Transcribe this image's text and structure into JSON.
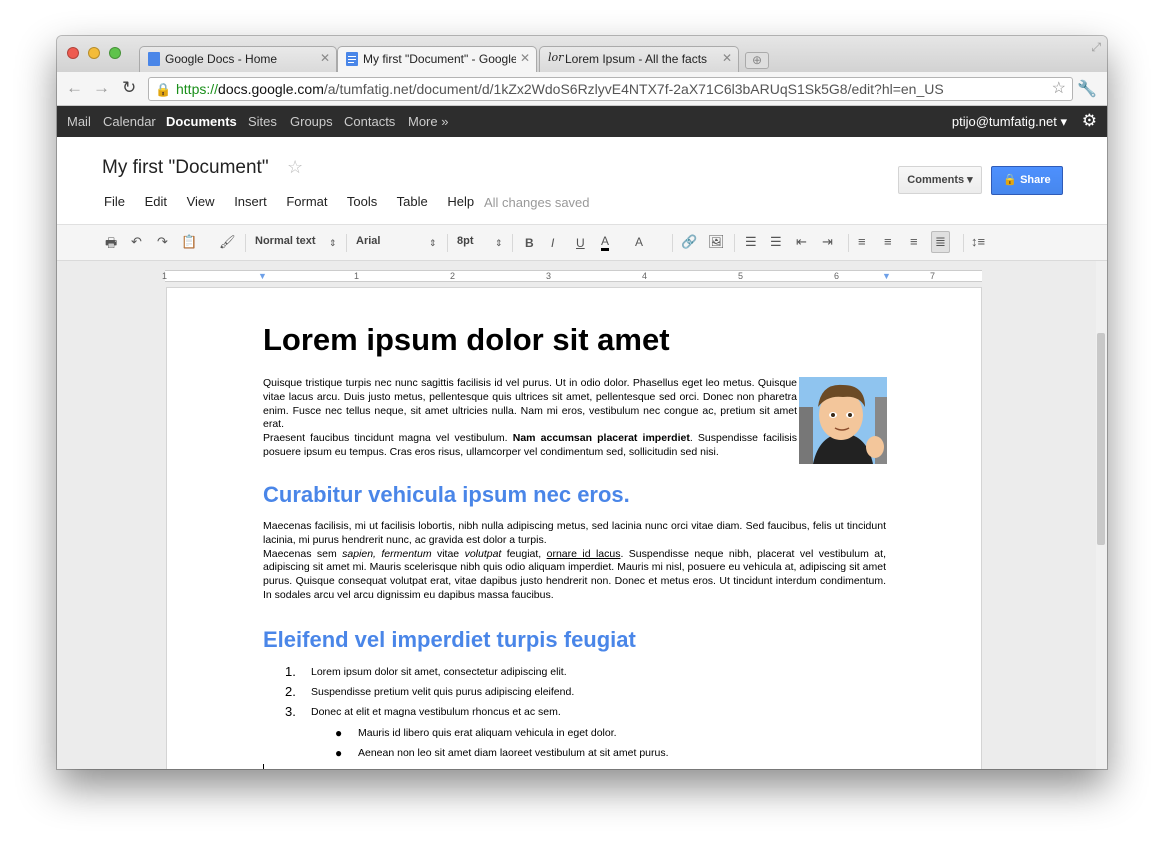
{
  "browser": {
    "tabs": [
      {
        "label": "Google Docs - Home",
        "close": "✕"
      },
      {
        "label": "My first \"Document\" - Google",
        "close": "✕"
      },
      {
        "label": "Lorem Ipsum - All the facts",
        "close": "✕"
      }
    ],
    "new_tab": "⊕",
    "url_proto": "https://",
    "url_domain": "docs.google.com",
    "url_path": "/a/tumfatig.net/document/d/1kZx2WdoS6RzlyvE4NTX7f-2aX71C6l3bARUqS1Sk5G8/edit?hl=en_US"
  },
  "gbar": {
    "links": [
      "Mail",
      "Calendar",
      "Documents",
      "Sites",
      "Groups",
      "Contacts",
      "More »"
    ],
    "user": "ptijo@tumfatig.net ▾"
  },
  "doc": {
    "title": "My first \"Document\"",
    "menus": [
      "File",
      "Edit",
      "View",
      "Insert",
      "Format",
      "Tools",
      "Table",
      "Help"
    ],
    "saved_status": "All changes saved",
    "comments_label": "Comments ▾",
    "share_label": "Share"
  },
  "toolbar": {
    "style": "Normal text",
    "font": "Arial",
    "size": "8pt"
  },
  "ruler": [
    "1",
    "1",
    "2",
    "3",
    "4",
    "5",
    "6",
    "7"
  ],
  "content": {
    "heading": "Lorem ipsum dolor sit amet",
    "p1": "Quisque tristique turpis nec nunc sagittis facilisis id vel purus. Ut in odio dolor. Phasellus eget leo metus. Quisque vitae lacus arcu. Duis justo metus, pellentesque quis ultrices sit amet, pellentesque sed orci. Donec non pharetra enim. Fusce nec tellus neque, sit amet ultricies nulla. Nam mi eros, vestibulum nec congue ac, pretium sit amet erat.",
    "p2a": "Praesent faucibus tincidunt magna vel vestibulum. ",
    "p2b": "Nam accumsan placerat imperdiet",
    "p2c": ". Suspendisse facilisis posuere ipsum eu tempus. Cras eros risus, ullamcorper vel condimentum sed, sollicitudin sed nisi.",
    "h2a": "Curabitur vehicula ipsum nec eros.",
    "p3": "Maecenas facilisis, mi ut facilisis lobortis, nibh nulla adipiscing metus, sed lacinia nunc orci vitae diam. Sed faucibus, felis ut tincidunt lacinia, mi purus hendrerit nunc, ac gravida est dolor a turpis.",
    "p4a": "Maecenas sem ",
    "p4b": "sapien, fermentum",
    "p4c": " vitae ",
    "p4d": "volutpat",
    "p4e": " feugiat, ",
    "p4f": "ornare id lacus",
    "p4g": ". Suspendisse neque nibh, placerat vel vestibulum at, adipiscing sit amet mi. Mauris scelerisque nibh quis odio aliquam imperdiet. Mauris mi nisl, posuere eu vehicula at, adipiscing sit amet purus. Quisque consequat volutpat erat, vitae dapibus justo hendrerit non. Donec et metus eros. Ut tincidunt interdum condimentum. In sodales arcu vel arcu dignissim eu dapibus massa faucibus.",
    "h2b": "Eleifend vel imperdiet turpis feugiat",
    "ordered": [
      {
        "num": "1.",
        "text": "Lorem ipsum dolor sit amet, consectetur adipiscing elit."
      },
      {
        "num": "2.",
        "text": "Suspendisse pretium velit quis purus adipiscing eleifend."
      },
      {
        "num": "3.",
        "text": "Donec at elit et magna vestibulum rhoncus et ac sem."
      }
    ],
    "bullets": [
      {
        "dot": "●",
        "text": "Mauris id libero quis erat aliquam vehicula in eget dolor."
      },
      {
        "dot": "●",
        "text": "Aenean non leo sit amet diam laoreet vestibulum at sit amet purus."
      }
    ]
  }
}
